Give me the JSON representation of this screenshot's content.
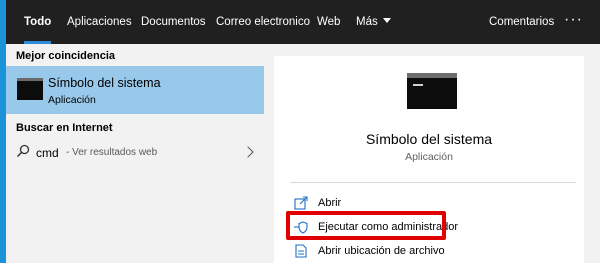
{
  "tabs": [
    {
      "label": "Todo",
      "active": true
    },
    {
      "label": "Aplicaciones",
      "active": false
    },
    {
      "label": "Documentos",
      "active": false
    },
    {
      "label": "Correo electronico",
      "active": false
    },
    {
      "label": "Web",
      "active": false
    },
    {
      "label": "Más",
      "active": false,
      "has_dropdown": true
    }
  ],
  "feedback_label": "Comentarios",
  "more_options_label": "···",
  "left": {
    "best_match_heading": "Mejor coincidencia",
    "best_match": {
      "title": "Símbolo del sistema",
      "subtitle": "Aplicación",
      "icon": "command-prompt-icon"
    },
    "web_heading": "Buscar en Internet",
    "web_result": {
      "query": "cmd",
      "hint": "- Ver resultados web",
      "icon": "search-icon"
    }
  },
  "detail": {
    "title": "Símbolo del sistema",
    "type": "Aplicación",
    "actions": [
      {
        "label": "Abrir",
        "icon": "open-icon"
      },
      {
        "label": "Ejecutar como administrador",
        "icon": "shield-icon",
        "highlighted": true
      },
      {
        "label": "Abrir ubicación de archivo",
        "icon": "file-location-icon"
      }
    ]
  },
  "colors": {
    "accent": "#2d8bd9",
    "highlight": "#e00000",
    "selection": "#99c9ea",
    "topbar": "#202020"
  }
}
